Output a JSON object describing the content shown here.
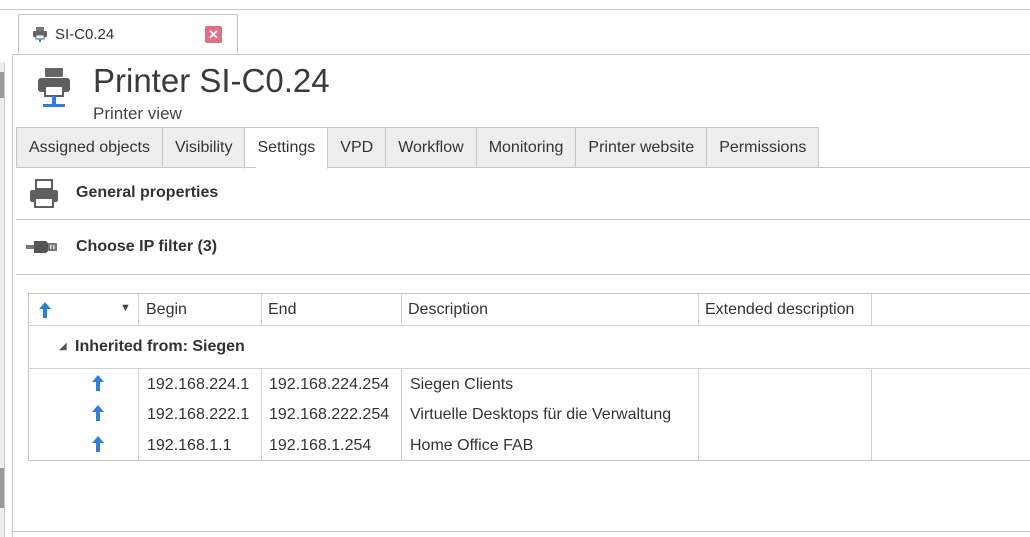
{
  "document_tab": {
    "label": "SI-C0.24",
    "close_symbol": "✕"
  },
  "header": {
    "title": "Printer SI-C0.24",
    "subtitle": "Printer view"
  },
  "tabs": [
    {
      "label": "Assigned objects"
    },
    {
      "label": "Visibility"
    },
    {
      "label": "Settings",
      "active": true
    },
    {
      "label": "VPD"
    },
    {
      "label": "Workflow"
    },
    {
      "label": "Monitoring"
    },
    {
      "label": "Printer website"
    },
    {
      "label": "Permissions"
    }
  ],
  "sections": {
    "general": {
      "title": "General properties"
    },
    "ip_filter": {
      "title": "Choose IP filter (3)"
    }
  },
  "grid": {
    "columns": [
      "Begin",
      "End",
      "Description",
      "Extended description"
    ],
    "group": {
      "label": "Inherited from: Siegen"
    },
    "rows": [
      {
        "begin": "192.168.224.1",
        "end": "192.168.224.254",
        "description": "Siegen Clients",
        "extended": ""
      },
      {
        "begin": "192.168.222.1",
        "end": "192.168.222.254",
        "description": "Virtuelle Desktops für die Verwaltung",
        "extended": ""
      },
      {
        "begin": "192.168.1.1",
        "end": "192.168.1.254",
        "description": "Home Office FAB",
        "extended": ""
      }
    ]
  },
  "colors": {
    "accent_blue": "#2f7fd6",
    "close_red": "#e26f83"
  }
}
